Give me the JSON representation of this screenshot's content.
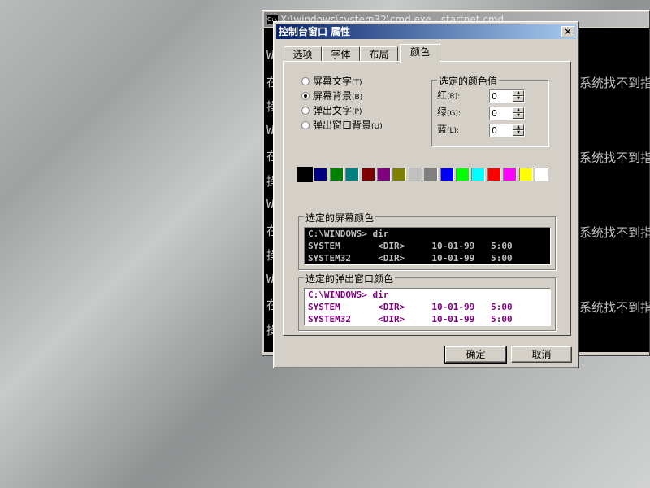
{
  "cmd": {
    "title": "X:\\windows\\system32\\cmd.exe - startnet.cmd",
    "left_lines": [
      "W",
      "在",
      "操",
      "W",
      "在",
      "操",
      "W",
      "在",
      "操",
      "W",
      "在",
      "操"
    ],
    "right_lines": [
      "系统找不到指",
      "系统找不到指",
      "系统找不到指",
      "系统找不到指"
    ]
  },
  "dialog": {
    "title": "控制台窗口 属性",
    "close": "×",
    "tabs": [
      {
        "label": "选项"
      },
      {
        "label": "字体"
      },
      {
        "label": "布局"
      },
      {
        "label": "颜色"
      }
    ],
    "radios": [
      {
        "label": "屏幕文字",
        "hotkey": "(T)",
        "checked": false
      },
      {
        "label": "屏幕背景",
        "hotkey": "(B)",
        "checked": true
      },
      {
        "label": "弹出文字",
        "hotkey": "(P)",
        "checked": false
      },
      {
        "label": "弹出窗口背景",
        "hotkey": "(U)",
        "checked": false
      }
    ],
    "color_values": {
      "legend": "选定的颜色值",
      "rows": [
        {
          "label": "红",
          "hotkey": "(R):",
          "value": "0"
        },
        {
          "label": "绿",
          "hotkey": "(G):",
          "value": "0"
        },
        {
          "label": "蓝",
          "hotkey": "(L):",
          "value": "0"
        }
      ]
    },
    "palette": [
      "#000000",
      "#000080",
      "#008000",
      "#008080",
      "#800000",
      "#800080",
      "#808000",
      "#c0c0c0",
      "#808080",
      "#0000ff",
      "#00ff00",
      "#00ffff",
      "#ff0000",
      "#ff00ff",
      "#ffff00",
      "#ffffff"
    ],
    "screen_preview": {
      "legend": "选定的屏幕颜色",
      "bg": "#000000",
      "fg": "#c0c0c0",
      "lines": [
        "C:\\WINDOWS> dir",
        "SYSTEM       <DIR>     10-01-99   5:00",
        "SYSTEM32     <DIR>     10-01-99   5:00"
      ]
    },
    "popup_preview": {
      "legend": "选定的弹出窗口颜色",
      "bg": "#ffffff",
      "fg": "#800080",
      "lines": [
        "C:\\WINDOWS> dir",
        "SYSTEM       <DIR>     10-01-99   5:00",
        "SYSTEM32     <DIR>     10-01-99   5:00"
      ]
    },
    "ok": "确定",
    "cancel": "取消"
  }
}
